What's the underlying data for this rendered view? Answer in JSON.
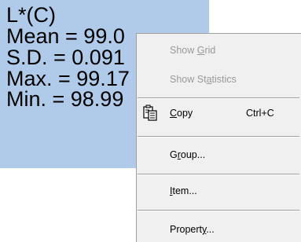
{
  "stats": {
    "title": "L*(C)",
    "mean": "Mean = 99.0",
    "sd": "S.D. = 0.091",
    "max": "Max. = 99.17",
    "min": "Min. = 98.99"
  },
  "menu": {
    "show_grid": {
      "pre": "Show ",
      "key": "G",
      "post": "rid"
    },
    "show_statistics": {
      "pre": "Show St",
      "key": "a",
      "post": "tistics"
    },
    "copy": {
      "pre": "",
      "key": "C",
      "post": "opy",
      "shortcut": "Ctrl+C",
      "icon": "copy-icon"
    },
    "group": {
      "pre": "G",
      "key": "r",
      "post": "oup..."
    },
    "item": {
      "pre": "",
      "key": "I",
      "post": "tem..."
    },
    "property": {
      "pre": "Propert",
      "key": "y",
      "post": "..."
    }
  },
  "colors": {
    "panel_bg": "#b0cbe9",
    "menu_bg": "#f0f0f0",
    "disabled_text": "#9a9a9a"
  }
}
